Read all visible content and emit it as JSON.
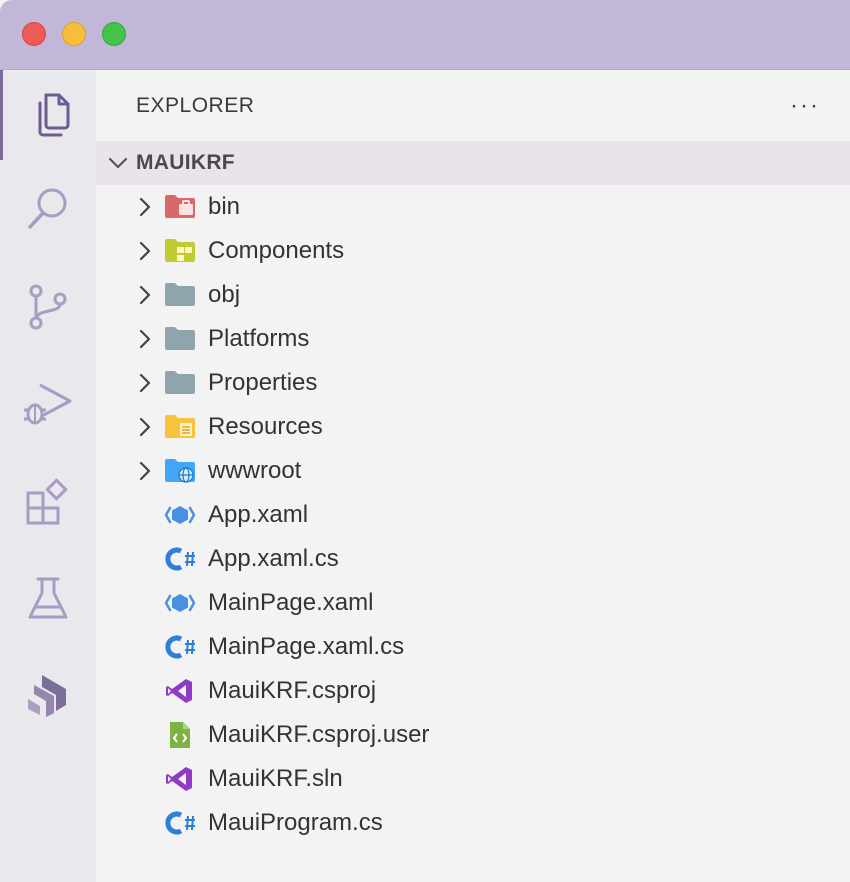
{
  "window": {
    "buttons": {
      "close": "close-button",
      "minimize": "minimize-button",
      "maximize": "maximize-button"
    }
  },
  "activity_bar": {
    "items": [
      {
        "name": "explorer",
        "icon": "files-icon",
        "active": true
      },
      {
        "name": "search",
        "icon": "search-icon",
        "active": false
      },
      {
        "name": "source-control",
        "icon": "source-control-icon",
        "active": false
      },
      {
        "name": "run-and-debug",
        "icon": "run-debug-icon",
        "active": false
      },
      {
        "name": "extensions",
        "icon": "extensions-icon",
        "active": false
      },
      {
        "name": "testing",
        "icon": "flask-icon",
        "active": false
      },
      {
        "name": "deploy",
        "icon": "deploy-icon",
        "active": false
      }
    ]
  },
  "explorer": {
    "title": "EXPLORER",
    "more_label": "···",
    "root_folder": "MAUIKRF",
    "items": [
      {
        "label": "bin",
        "kind": "folder",
        "icon": "folder-bin-icon",
        "color": "#d9686a"
      },
      {
        "label": "Components",
        "kind": "folder",
        "icon": "folder-components-icon",
        "color": "#c0ca33"
      },
      {
        "label": "obj",
        "kind": "folder",
        "icon": "folder-icon",
        "color": "#90a4ae"
      },
      {
        "label": "Platforms",
        "kind": "folder",
        "icon": "folder-icon",
        "color": "#90a4ae"
      },
      {
        "label": "Properties",
        "kind": "folder",
        "icon": "folder-icon",
        "color": "#90a4ae"
      },
      {
        "label": "Resources",
        "kind": "folder",
        "icon": "folder-resources-icon",
        "color": "#f9c23c"
      },
      {
        "label": "wwwroot",
        "kind": "folder",
        "icon": "folder-www-icon",
        "color": "#42a5f5"
      },
      {
        "label": "App.xaml",
        "kind": "file",
        "icon": "xaml-icon",
        "color": "#4a90e2"
      },
      {
        "label": "App.xaml.cs",
        "kind": "file",
        "icon": "csharp-icon",
        "color": "#2f7ed8"
      },
      {
        "label": "MainPage.xaml",
        "kind": "file",
        "icon": "xaml-icon",
        "color": "#4a90e2"
      },
      {
        "label": "MainPage.xaml.cs",
        "kind": "file",
        "icon": "csharp-icon",
        "color": "#2f7ed8"
      },
      {
        "label": "MauiKRF.csproj",
        "kind": "file",
        "icon": "visual-studio-icon",
        "color": "#8e3cc6"
      },
      {
        "label": "MauiKRF.csproj.user",
        "kind": "file",
        "icon": "user-file-icon",
        "color": "#7cb342"
      },
      {
        "label": "MauiKRF.sln",
        "kind": "file",
        "icon": "visual-studio-icon",
        "color": "#8e3cc6"
      },
      {
        "label": "MauiProgram.cs",
        "kind": "file",
        "icon": "csharp-icon",
        "color": "#2f7ed8"
      }
    ]
  },
  "colors": {
    "titlebar": "#c3b7d9",
    "activity_bar": "#e8e8ed",
    "sidebar": "#f3f3f3",
    "root_row": "#e9e4ea"
  }
}
